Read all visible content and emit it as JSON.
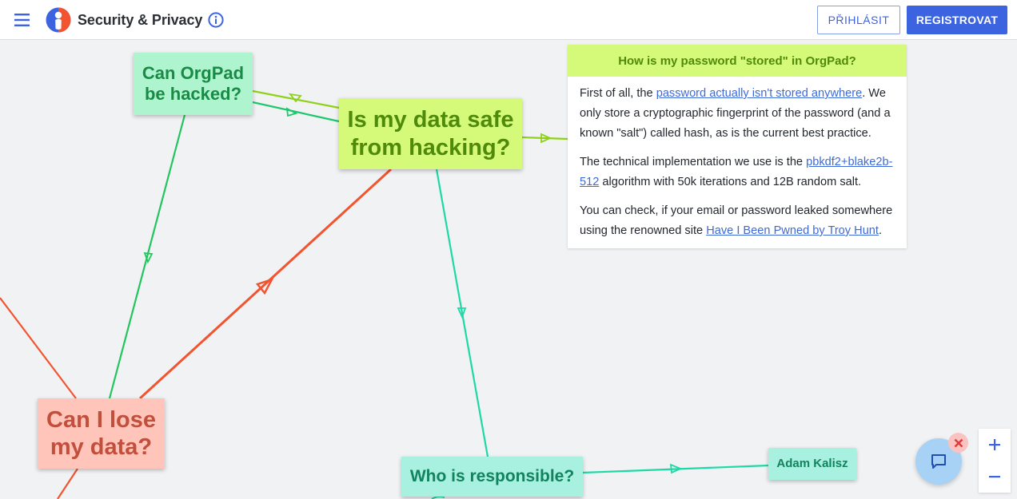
{
  "header": {
    "title": "Security & Privacy",
    "login_label": "PŘIHLÁSIT",
    "register_label": "REGISTROVAT",
    "icons": {
      "menu": "hamburger-icon",
      "logo": "orgpad-logo",
      "info": "info-icon"
    },
    "accent_color": "#3c64e0"
  },
  "cards": {
    "hacked": "Can OrgPad be hacked?",
    "safe": "Is my data safe from hacking?",
    "lose": "Can I lose my data?",
    "responsible": "Who is responsible?",
    "adam": "Adam Kalisz"
  },
  "panel": {
    "title": "How is my password \"stored\" in OrgPad?",
    "p1_before": "First of all, the ",
    "p1_link": "password actually isn't stored anywhere",
    "p1_after": ". We only store a cryptographic fingerprint of the password (and a known \"salt\") called hash, as is the current best practice.",
    "p2_before": "The technical implementation we use is the ",
    "p2_link": "pbkdf2+blake2b-512",
    "p2_after": " algorithm with 50k iterations and 12B random salt.",
    "p3_before": "You can check, if your email or password leaked somewhere using the renowned site ",
    "p3_link": "Have I Been Pwned by Troy Hunt",
    "p3_after": "."
  },
  "colors": {
    "green_link": "#22c55e",
    "lime_link": "#8fd11a",
    "teal_link": "#1dd9a6",
    "red_link": "#f25430"
  },
  "controls": {
    "chat_icon": "chat-icon",
    "close_icon": "close-icon",
    "zoom_in_icon": "plus-icon",
    "zoom_out_icon": "minus-icon"
  }
}
